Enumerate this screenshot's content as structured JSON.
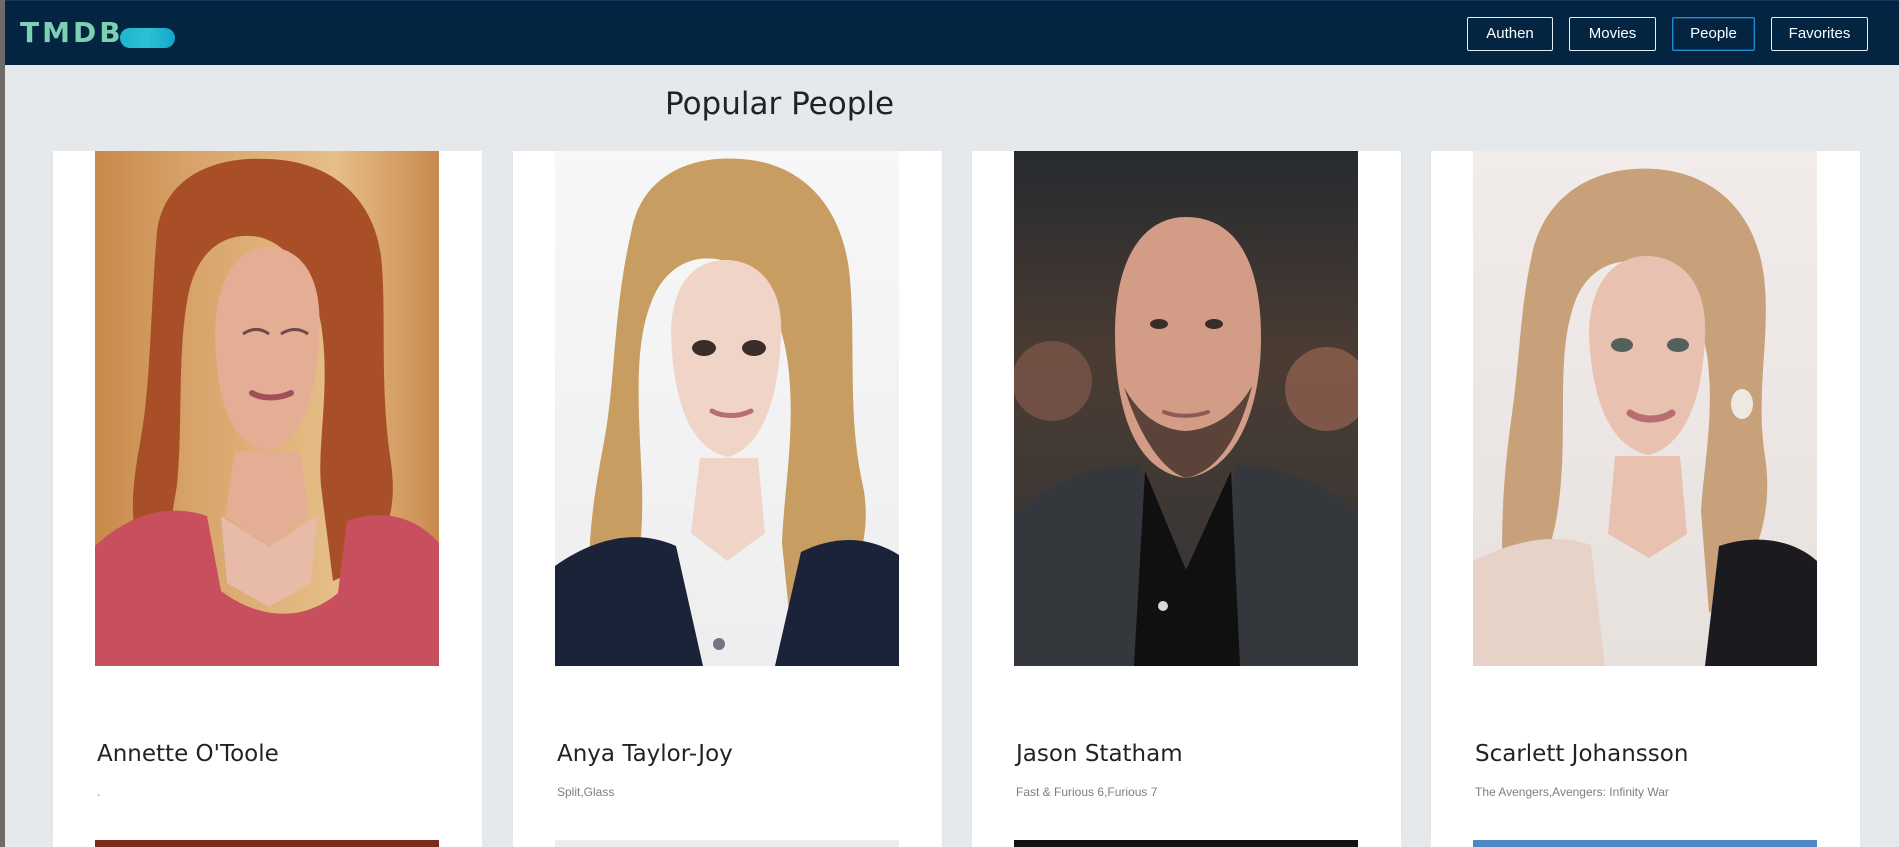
{
  "app": {
    "logo_text": "TMDB"
  },
  "nav": {
    "authen": "Authen",
    "movies": "Movies",
    "people": "People",
    "favorites": "Favorites",
    "active": "people"
  },
  "page": {
    "title": "Popular People"
  },
  "people": [
    {
      "name": "Annette O'Toole",
      "known_for": ".",
      "photo_icon": "person-photo"
    },
    {
      "name": "Anya Taylor-Joy",
      "known_for": "Split,Glass",
      "photo_icon": "person-photo"
    },
    {
      "name": "Jason Statham",
      "known_for": "Fast & Furious 6,Furious 7",
      "photo_icon": "person-photo"
    },
    {
      "name": "Scarlett Johansson",
      "known_for": "The Avengers,Avengers: Infinity War",
      "photo_icon": "person-photo"
    }
  ],
  "colors": {
    "navbar": "#032541",
    "page_bg": "#e6e9ec",
    "logo_text": "#7fd0b3",
    "logo_accent": "#1bb6cf",
    "active_nav_border": "#1f8fd6"
  }
}
